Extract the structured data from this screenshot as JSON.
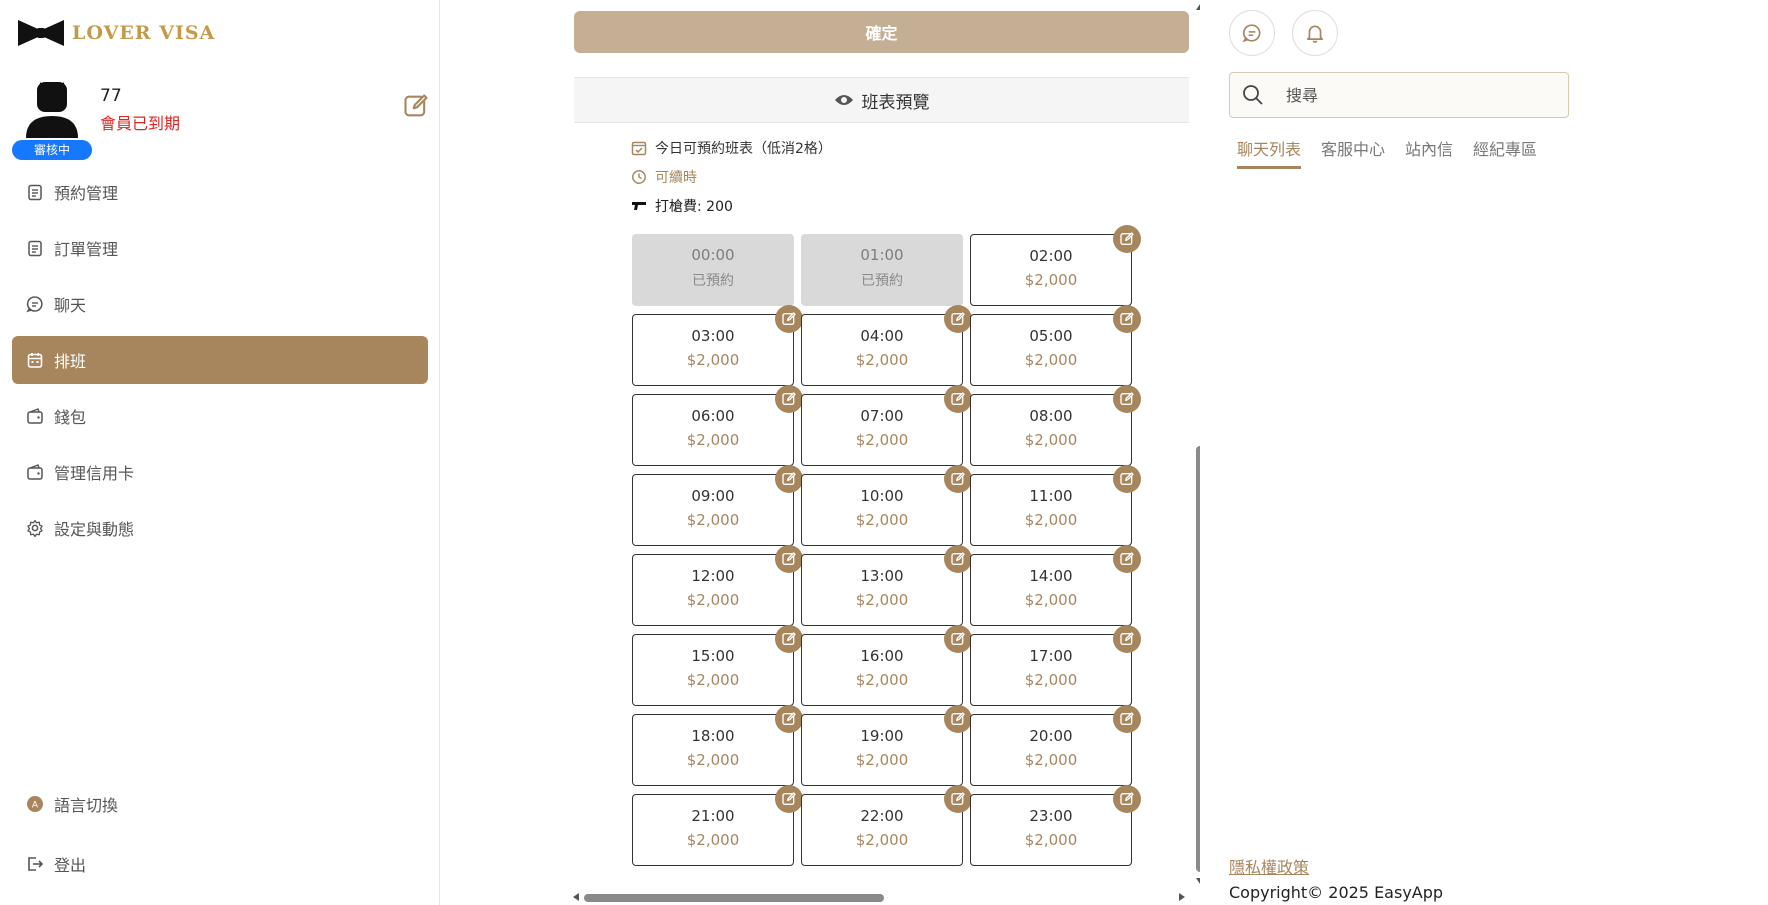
{
  "brand": {
    "name": "LOVER VISA"
  },
  "profile": {
    "name": "77",
    "member_status": "會員已到期",
    "review_status": "審核中"
  },
  "nav": {
    "items": [
      {
        "label": "預約管理",
        "icon": "clipboard-icon"
      },
      {
        "label": "訂單管理",
        "icon": "clipboard-icon"
      },
      {
        "label": "聊天",
        "icon": "chat-icon"
      },
      {
        "label": "排班",
        "icon": "calendar-icon"
      },
      {
        "label": "錢包",
        "icon": "wallet-icon"
      },
      {
        "label": "管理信用卡",
        "icon": "wallet-icon"
      },
      {
        "label": "設定與動態",
        "icon": "gear-icon"
      }
    ],
    "language": "語言切換",
    "logout": "登出"
  },
  "schedule": {
    "confirm_label": "確定",
    "preview_label": "班表預覽",
    "info_today": "今日可預約班表（低消2格）",
    "info_extend": "可續時",
    "info_fee": "打槍費: 200",
    "slots": [
      {
        "time": "00:00",
        "price": "已預約",
        "booked": true
      },
      {
        "time": "01:00",
        "price": "已預約",
        "booked": true
      },
      {
        "time": "02:00",
        "price": "$2,000",
        "booked": false
      },
      {
        "time": "03:00",
        "price": "$2,000",
        "booked": false
      },
      {
        "time": "04:00",
        "price": "$2,000",
        "booked": false
      },
      {
        "time": "05:00",
        "price": "$2,000",
        "booked": false
      },
      {
        "time": "06:00",
        "price": "$2,000",
        "booked": false
      },
      {
        "time": "07:00",
        "price": "$2,000",
        "booked": false
      },
      {
        "time": "08:00",
        "price": "$2,000",
        "booked": false
      },
      {
        "time": "09:00",
        "price": "$2,000",
        "booked": false
      },
      {
        "time": "10:00",
        "price": "$2,000",
        "booked": false
      },
      {
        "time": "11:00",
        "price": "$2,000",
        "booked": false
      },
      {
        "time": "12:00",
        "price": "$2,000",
        "booked": false
      },
      {
        "time": "13:00",
        "price": "$2,000",
        "booked": false
      },
      {
        "time": "14:00",
        "price": "$2,000",
        "booked": false
      },
      {
        "time": "15:00",
        "price": "$2,000",
        "booked": false
      },
      {
        "time": "16:00",
        "price": "$2,000",
        "booked": false
      },
      {
        "time": "17:00",
        "price": "$2,000",
        "booked": false
      },
      {
        "time": "18:00",
        "price": "$2,000",
        "booked": false
      },
      {
        "time": "19:00",
        "price": "$2,000",
        "booked": false
      },
      {
        "time": "20:00",
        "price": "$2,000",
        "booked": false
      },
      {
        "time": "21:00",
        "price": "$2,000",
        "booked": false
      },
      {
        "time": "22:00",
        "price": "$2,000",
        "booked": false
      },
      {
        "time": "23:00",
        "price": "$2,000",
        "booked": false
      }
    ]
  },
  "right_panel": {
    "search_placeholder": "搜尋",
    "tabs": [
      "聊天列表",
      "客服中心",
      "站內信",
      "經紀專區"
    ],
    "privacy": "隱私權政策",
    "copyright": "Copyright© 2025 EasyApp"
  },
  "colors": {
    "accent": "#a7865e",
    "confirm": "#c4ae94",
    "danger": "#e02424",
    "badge": "#1677ff"
  }
}
